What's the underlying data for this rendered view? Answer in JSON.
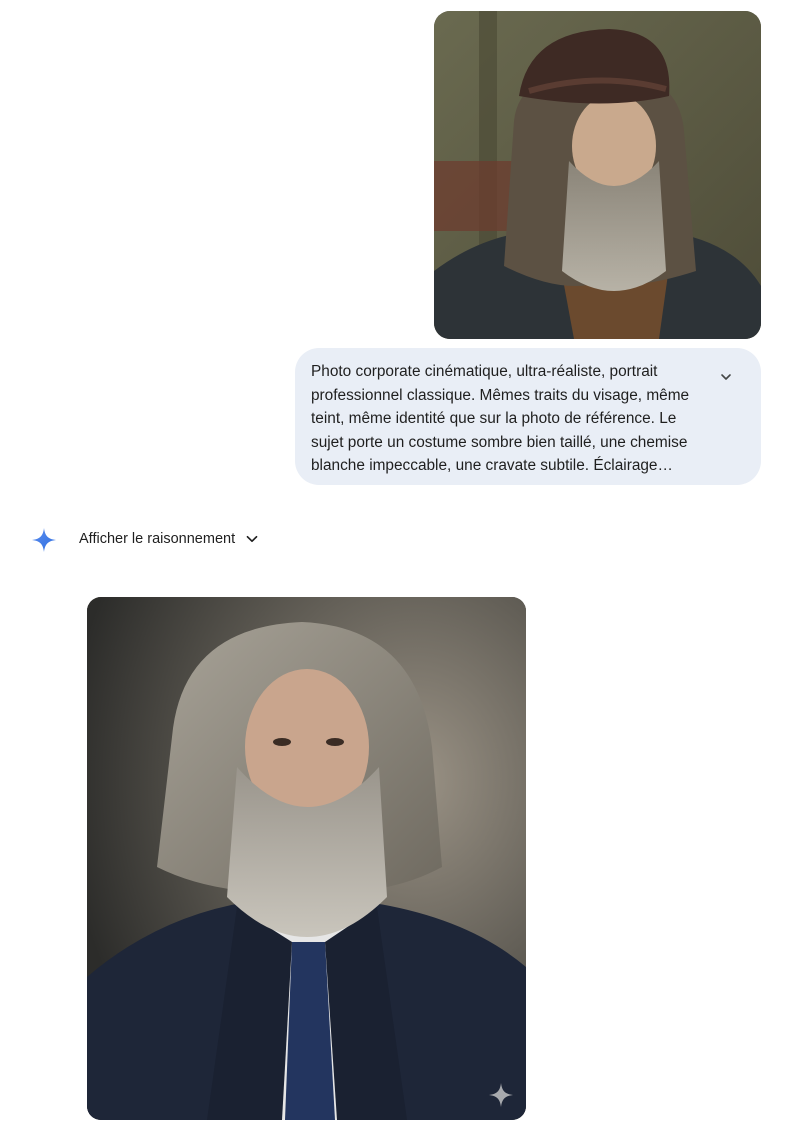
{
  "conversation": {
    "user_image": {
      "icon": "reference-portrait-image"
    },
    "prompt": {
      "text": "Photo corporate cinématique, ultra-réaliste, portrait professionnel classique. Mêmes traits du visage, même teint, même identité que sur la photo de référence. Le sujet porte un costume sombre bien taillé, une chemise blanche impeccable, une cravate subtile. Éclairage…",
      "expand_icon": "chevron-down-icon"
    },
    "response": {
      "logo_icon": "gemini-sparkle-icon",
      "reasoning_label": "Afficher le raisonnement",
      "reasoning_icon": "chevron-down-icon",
      "generated_image": {
        "icon": "generated-portrait-image",
        "watermark_icon": "sparkle-watermark-icon"
      }
    }
  },
  "colors": {
    "bubble_bg": "#e9eef6",
    "text": "#1f1f1f",
    "sparkle_blue": "#4285f4"
  }
}
